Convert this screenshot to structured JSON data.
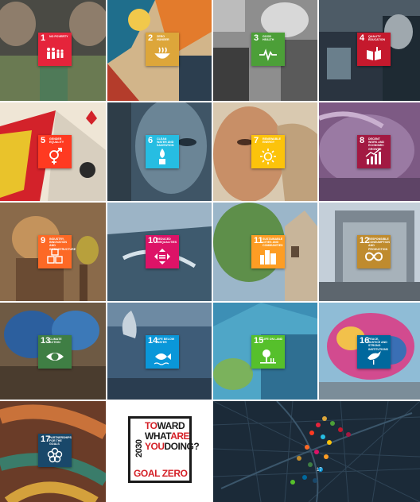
{
  "goals": [
    {
      "num": "1",
      "label": "No poverty",
      "color": "#e5243b",
      "icon": "people-icon"
    },
    {
      "num": "2",
      "label": "Zero hunger",
      "color": "#dda63a",
      "icon": "bowl-icon"
    },
    {
      "num": "3",
      "label": "Good health",
      "color": "#4c9f38",
      "icon": "heartbeat-icon"
    },
    {
      "num": "4",
      "label": "Quality education",
      "color": "#c5192d",
      "icon": "book-icon"
    },
    {
      "num": "5",
      "label": "Gender equality",
      "color": "#ff3a21",
      "icon": "gender-icon"
    },
    {
      "num": "6",
      "label": "Clean water and sanitation",
      "color": "#26bde2",
      "icon": "water-drop-icon"
    },
    {
      "num": "7",
      "label": "Renewable energy",
      "color": "#fcc30b",
      "icon": "sun-icon"
    },
    {
      "num": "8",
      "label": "Decent work and economic growth",
      "color": "#a21942",
      "icon": "bar-chart-icon"
    },
    {
      "num": "9",
      "label": "Industry, innovation and infrastructure",
      "color": "#fd6925",
      "icon": "cubes-icon"
    },
    {
      "num": "10",
      "label": "Reduced inequalities",
      "color": "#dd1367",
      "icon": "arrows-icon"
    },
    {
      "num": "11",
      "label": "Sustainable cities and communities",
      "color": "#fd9d24",
      "icon": "buildings-icon"
    },
    {
      "num": "12",
      "label": "Responsible consumption and production",
      "color": "#bf8b2e",
      "icon": "infinity-icon"
    },
    {
      "num": "13",
      "label": "Climate action",
      "color": "#3f7e44",
      "icon": "eye-globe-icon"
    },
    {
      "num": "14",
      "label": "Life below water",
      "color": "#0a97d9",
      "icon": "fish-icon"
    },
    {
      "num": "15",
      "label": "Life on land",
      "color": "#56c02b",
      "icon": "tree-icon"
    },
    {
      "num": "16",
      "label": "Peace, justice and strong institutions",
      "color": "#00689d",
      "icon": "dove-icon"
    },
    {
      "num": "17",
      "label": "Partnerships for the goals",
      "color": "#19486a",
      "icon": "flower-icon"
    }
  ],
  "toward": {
    "year": "2030",
    "line1a": "TO",
    "line1b": "WARD",
    "line2a": "WHAT",
    "line2b": "ARE",
    "line3a": "YOU",
    "line3b": "DOING?",
    "goal_zero": "GOAL ZERO"
  },
  "map_label": "17"
}
